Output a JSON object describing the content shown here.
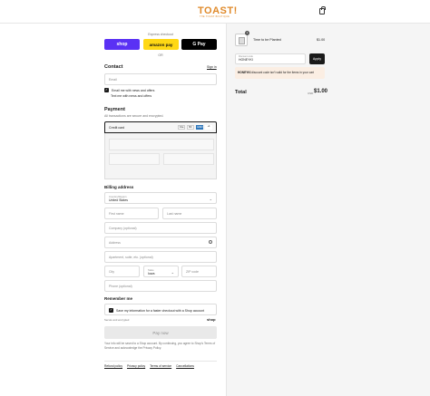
{
  "header": {
    "logo_text": "TOAST!",
    "logo_tagline": "THE TOAST BOUTIQUE"
  },
  "express": {
    "label": "Express checkout",
    "shop_label": "shop",
    "amazon_label": "amazon pay",
    "gpay_label": "G Pay",
    "or_label": "OR"
  },
  "contact": {
    "heading": "Contact",
    "signin": "Sign in",
    "email_placeholder": "Email",
    "news_checkbox": "Email me with news and offers",
    "text_checkbox": "Text me with news and offers"
  },
  "payment": {
    "heading": "Payment",
    "subtitle": "All transactions are secure and encrypted.",
    "method": "Credit card",
    "card_logos": [
      "Visa",
      "MC",
      "AMEX",
      "+4"
    ]
  },
  "billing": {
    "heading": "Billing address",
    "country_label": "Country/Region",
    "country_value": "United States",
    "first_name": "First name",
    "last_name": "Last name",
    "company": "Company (optional)",
    "address": "Address",
    "apartment": "Apartment, suite, etc. (optional)",
    "city": "City",
    "state_label": "State",
    "state_value": "Iowa",
    "zip": "ZIP code",
    "phone": "Phone (optional)"
  },
  "remember": {
    "heading": "Remember me",
    "save_info": "Save my information for a faster checkout with a Shop account",
    "secure_note": "Secure and encrypted",
    "shop_brand": "shop"
  },
  "pay_now": "Pay now",
  "legal_text": "Your info will be saved to a Shop account. By continuing, you agree to Shop's Terms of Service and acknowledge the Privacy Policy.",
  "footer_links": [
    "Refund policy",
    "Privacy policy",
    "Terms of service",
    "Cancellations"
  ],
  "summary": {
    "qty": "1",
    "item_name": "Time to be Planted",
    "item_price": "$1.00",
    "discount_label": "Discount code",
    "discount_value": "HONEYKI",
    "apply_label": "Apply",
    "error_code": "HONEYKI",
    "error_message": " discount code isn't valid for the items in your cart",
    "total_label": "Total",
    "currency": "USD",
    "total_value": "$1.00"
  },
  "colors": {
    "shop_purple": "#5a31f4",
    "amazon_yellow": "#ffd814",
    "logo_orange": "#e08a2a",
    "error_bg": "#fbeee3"
  }
}
